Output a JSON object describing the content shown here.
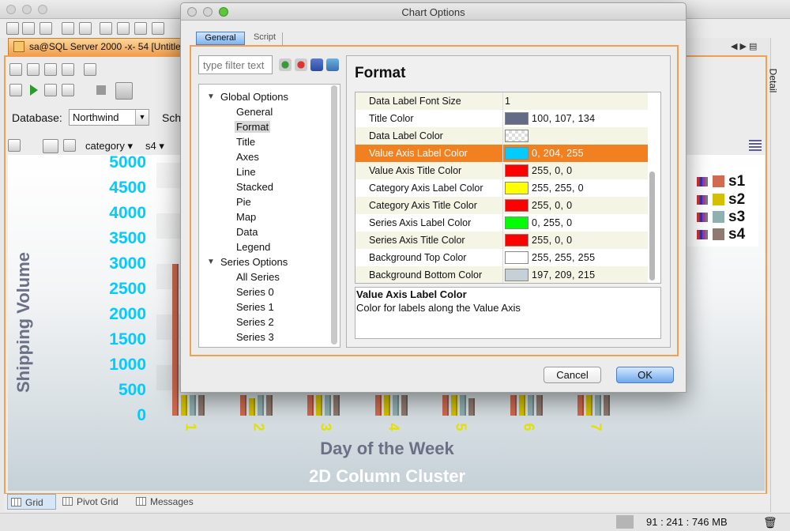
{
  "app": {
    "doc_tab_title": "sa@SQL Server 2000 -x- 54 [Untitled]",
    "database_label": "Database:",
    "database_value": "Northwind",
    "schema_label_cut": "Sch",
    "category_select": "category",
    "series_select": "s4",
    "right_rail_tab": "Detail",
    "bottom_tabs": [
      "Grid",
      "Pivot Grid",
      "Messages"
    ],
    "memory_status": "91 : 241 : 746 MB"
  },
  "chart_data": {
    "type": "bar",
    "title": "2D Column Cluster",
    "xlabel": "Day of the Week",
    "ylabel": "Shipping Volume",
    "categories": [
      "1",
      "2",
      "3",
      "4",
      "5",
      "6",
      "7"
    ],
    "yticks": [
      "5000",
      "4500",
      "4000",
      "3500",
      "3000",
      "2500",
      "2000",
      "1500",
      "1000",
      "500",
      "0"
    ],
    "ylim": [
      0,
      5000
    ],
    "series": [
      {
        "name": "s1",
        "color": "#d06a50",
        "values": [
          3000,
          400,
          400,
          400,
          400,
          400,
          400
        ]
      },
      {
        "name": "s2",
        "color": "#d4c000",
        "values": [
          400,
          350,
          400,
          400,
          400,
          400,
          400
        ]
      },
      {
        "name": "s3",
        "color": "#8fb0b0",
        "values": [
          400,
          400,
          400,
          400,
          400,
          400,
          400
        ]
      },
      {
        "name": "s4",
        "color": "#8e7a70",
        "values": [
          400,
          400,
          400,
          400,
          350,
          400,
          400
        ]
      }
    ],
    "legend": "top-right",
    "colors": {
      "tick_labels": "#00ccff",
      "axis_titles": "#6b7086",
      "category_labels": "#e4e000"
    }
  },
  "dialog": {
    "title": "Chart Options",
    "tabs": [
      "General",
      "Script"
    ],
    "filter_placeholder": "type filter text",
    "tree": {
      "global_options": "Global Options",
      "global_children": [
        "General",
        "Format",
        "Title",
        "Axes",
        "Line",
        "Stacked",
        "Pie",
        "Map",
        "Data",
        "Legend"
      ],
      "series_options": "Series Options",
      "series_children": [
        "All Series",
        "Series 0",
        "Series 1",
        "Series 2",
        "Series 3"
      ]
    },
    "heading": "Format",
    "properties": [
      {
        "name": "Data Label Font Size",
        "value": "1",
        "swatch": ""
      },
      {
        "name": "Title Color",
        "value": "100, 107, 134",
        "swatch": "#646b86"
      },
      {
        "name": "Data Label Color",
        "value": "",
        "swatch": "checker"
      },
      {
        "name": "Value Axis Label Color",
        "value": "0, 204, 255",
        "swatch": "#00ccff"
      },
      {
        "name": "Value Axis Title Color",
        "value": "255, 0, 0",
        "swatch": "#ff0000"
      },
      {
        "name": "Category Axis Label Color",
        "value": "255, 255, 0",
        "swatch": "#ffff00"
      },
      {
        "name": "Category Axis Title Color",
        "value": "255, 0, 0",
        "swatch": "#ff0000"
      },
      {
        "name": "Series Axis Label Color",
        "value": "0, 255, 0",
        "swatch": "#00ff00"
      },
      {
        "name": "Series Axis Title Color",
        "value": "255, 0, 0",
        "swatch": "#ff0000"
      },
      {
        "name": "Background Top Color",
        "value": "255, 255, 255",
        "swatch": "#ffffff"
      },
      {
        "name": "Background Bottom Color",
        "value": "197, 209, 215",
        "swatch": "#c5d1d7"
      }
    ],
    "selected_property": "Value Axis Label Color",
    "description_title": "Value Axis Label Color",
    "description_text": "Color for labels along the Value Axis",
    "cancel_label": "Cancel",
    "ok_label": "OK"
  }
}
